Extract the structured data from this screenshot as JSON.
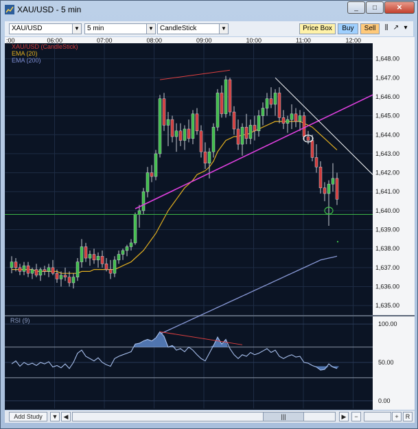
{
  "window": {
    "title": "XAU/USD - 5 min",
    "controls": [
      "_",
      "□",
      "✕"
    ]
  },
  "toolbar": {
    "symbol": "XAU/USD",
    "interval": "5 min",
    "chart_style": "CandleStick",
    "price_box_label": "Price Box",
    "buy_label": "Buy",
    "sell_label": "Sell",
    "colors": {
      "price_box": "#fff2a8",
      "buy": "#9fd0ff",
      "sell": "#ffc97a"
    }
  },
  "legend": [
    {
      "label": "XAU/USD (CandleStick)",
      "color": "#d33b3b"
    },
    {
      "label": "EMA (20)",
      "color": "#e3b020"
    },
    {
      "label": "EMA (200)",
      "color": "#7f8fd6"
    }
  ],
  "rsi_label": "RSI (9)",
  "bottom": {
    "add_study": "Add Study",
    "r_label": "R",
    "plus": "+",
    "minus": "−"
  },
  "chart_data": [
    {
      "type": "candlestick",
      "title": "XAU/USD - 5 min",
      "time_labels": [
        ":00",
        "06:00",
        "07:00",
        "08:00",
        "09:00",
        "10:00",
        "11:00",
        "12:00"
      ],
      "ylim": [
        1634.5,
        1649.0
      ],
      "y_tick_labels": [
        "1,648.00",
        "1,647.00",
        "1,646.00",
        "1,645.00",
        "1,644.00",
        "1,643.00",
        "1,642.00",
        "1,641.00",
        "1,640.00",
        "1,639.00",
        "1,638.00",
        "1,637.00",
        "1,636.00",
        "1,635.00"
      ],
      "y_ticks": [
        1648,
        1647,
        1646,
        1645,
        1644,
        1643,
        1642,
        1641,
        1640,
        1639,
        1638,
        1637,
        1636,
        1635
      ],
      "candles": [
        [
          1637.0,
          1637.6,
          1636.7,
          1637.3
        ],
        [
          1637.3,
          1637.5,
          1636.8,
          1637.0
        ],
        [
          1637.0,
          1637.2,
          1636.6,
          1636.8
        ],
        [
          1636.8,
          1637.3,
          1636.6,
          1637.1
        ],
        [
          1637.1,
          1637.3,
          1636.5,
          1636.7
        ],
        [
          1636.7,
          1637.0,
          1636.4,
          1636.9
        ],
        [
          1636.9,
          1637.2,
          1636.5,
          1636.6
        ],
        [
          1636.6,
          1637.0,
          1636.3,
          1636.9
        ],
        [
          1636.9,
          1637.1,
          1636.6,
          1636.8
        ],
        [
          1636.8,
          1637.2,
          1636.5,
          1637.0
        ],
        [
          1637.0,
          1637.4,
          1636.6,
          1636.7
        ],
        [
          1636.7,
          1636.9,
          1636.2,
          1636.4
        ],
        [
          1636.4,
          1636.8,
          1636.0,
          1636.6
        ],
        [
          1636.6,
          1637.0,
          1636.3,
          1636.5
        ],
        [
          1636.5,
          1636.8,
          1636.0,
          1636.2
        ],
        [
          1636.2,
          1636.7,
          1635.9,
          1636.5
        ],
        [
          1636.5,
          1637.5,
          1636.3,
          1637.3
        ],
        [
          1637.3,
          1638.5,
          1637.0,
          1638.1
        ],
        [
          1638.1,
          1638.3,
          1637.3,
          1637.5
        ],
        [
          1637.5,
          1637.9,
          1637.1,
          1637.7
        ],
        [
          1637.7,
          1638.0,
          1637.2,
          1637.4
        ],
        [
          1637.4,
          1637.8,
          1637.0,
          1637.6
        ],
        [
          1637.6,
          1637.9,
          1637.0,
          1637.2
        ],
        [
          1637.2,
          1637.5,
          1636.8,
          1636.9
        ],
        [
          1636.9,
          1637.4,
          1636.4,
          1636.7
        ],
        [
          1636.7,
          1637.6,
          1636.5,
          1637.4
        ],
        [
          1637.4,
          1637.9,
          1637.2,
          1637.7
        ],
        [
          1637.7,
          1638.0,
          1637.4,
          1637.9
        ],
        [
          1637.9,
          1638.2,
          1637.6,
          1638.1
        ],
        [
          1638.1,
          1638.5,
          1637.9,
          1638.3
        ],
        [
          1638.3,
          1639.9,
          1638.2,
          1639.8
        ],
        [
          1639.8,
          1640.3,
          1639.1,
          1640.0
        ],
        [
          1640.0,
          1641.2,
          1639.8,
          1641.0
        ],
        [
          1641.0,
          1642.3,
          1640.7,
          1642.0
        ],
        [
          1642.0,
          1642.4,
          1641.5,
          1641.8
        ],
        [
          1641.8,
          1643.2,
          1641.6,
          1643.0
        ],
        [
          1643.0,
          1646.1,
          1642.8,
          1645.9
        ],
        [
          1645.9,
          1646.2,
          1644.2,
          1644.5
        ],
        [
          1644.5,
          1645.2,
          1643.4,
          1644.8
        ],
        [
          1644.8,
          1645.0,
          1643.6,
          1643.9
        ],
        [
          1643.9,
          1644.6,
          1643.1,
          1644.2
        ],
        [
          1644.2,
          1644.6,
          1643.4,
          1643.7
        ],
        [
          1643.7,
          1644.5,
          1643.2,
          1644.3
        ],
        [
          1644.3,
          1644.8,
          1643.6,
          1643.8
        ],
        [
          1643.8,
          1645.3,
          1643.5,
          1645.1
        ],
        [
          1645.1,
          1645.4,
          1644.0,
          1644.2
        ],
        [
          1644.2,
          1644.5,
          1642.8,
          1643.1
        ],
        [
          1643.1,
          1643.6,
          1642.2,
          1642.5
        ],
        [
          1642.5,
          1643.3,
          1641.7,
          1643.1
        ],
        [
          1643.1,
          1644.6,
          1642.8,
          1644.4
        ],
        [
          1644.4,
          1646.4,
          1644.2,
          1646.2
        ],
        [
          1646.2,
          1646.6,
          1644.9,
          1645.1
        ],
        [
          1645.1,
          1647.1,
          1644.9,
          1646.9
        ],
        [
          1646.9,
          1647.0,
          1645.0,
          1645.2
        ],
        [
          1645.2,
          1645.5,
          1644.0,
          1644.3
        ],
        [
          1644.3,
          1644.8,
          1643.2,
          1643.5
        ],
        [
          1643.5,
          1644.6,
          1642.9,
          1644.4
        ],
        [
          1644.4,
          1645.1,
          1643.5,
          1643.8
        ],
        [
          1643.8,
          1644.8,
          1643.5,
          1644.5
        ],
        [
          1644.5,
          1645.0,
          1643.7,
          1644.2
        ],
        [
          1644.2,
          1645.3,
          1643.9,
          1645.0
        ],
        [
          1645.0,
          1645.7,
          1644.5,
          1645.4
        ],
        [
          1645.4,
          1646.2,
          1645.0,
          1645.9
        ],
        [
          1645.9,
          1646.5,
          1645.4,
          1645.6
        ],
        [
          1645.6,
          1646.4,
          1645.0,
          1646.2
        ],
        [
          1646.2,
          1646.5,
          1644.6,
          1644.9
        ],
        [
          1644.9,
          1645.3,
          1644.3,
          1644.6
        ],
        [
          1644.6,
          1645.0,
          1644.1,
          1644.8
        ],
        [
          1644.8,
          1645.6,
          1644.3,
          1645.1
        ],
        [
          1645.1,
          1645.4,
          1644.4,
          1644.7
        ],
        [
          1644.7,
          1645.3,
          1644.2,
          1645.0
        ],
        [
          1645.0,
          1645.2,
          1643.7,
          1643.9
        ],
        [
          1643.9,
          1644.2,
          1643.5,
          1643.7
        ],
        [
          1643.7,
          1644.0,
          1642.6,
          1642.8
        ],
        [
          1642.8,
          1643.5,
          1642.0,
          1642.3
        ],
        [
          1642.3,
          1642.6,
          1640.9,
          1641.2
        ],
        [
          1641.2,
          1641.5,
          1640.5,
          1640.9
        ],
        [
          1640.9,
          1641.6,
          1639.2,
          1641.4
        ],
        [
          1641.4,
          1642.5,
          1641.0,
          1641.7
        ],
        [
          1641.7,
          1642.0,
          1640.3,
          1640.6
        ]
      ],
      "series": [
        {
          "name": "EMA (20)",
          "values": [
            1636.9,
            1636.9,
            1636.9,
            1636.9,
            1636.9,
            1636.9,
            1636.8,
            1636.8,
            1636.8,
            1636.8,
            1636.8,
            1636.8,
            1636.7,
            1636.7,
            1636.7,
            1636.7,
            1636.7,
            1636.8,
            1636.8,
            1636.8,
            1636.9,
            1636.9,
            1636.9,
            1636.9,
            1636.9,
            1636.9,
            1637.0,
            1637.1,
            1637.2,
            1637.3,
            1637.5,
            1637.7,
            1637.9,
            1638.2,
            1638.5,
            1638.8,
            1639.2,
            1639.6,
            1640.0,
            1640.3,
            1640.6,
            1640.9,
            1641.2,
            1641.4,
            1641.6,
            1641.9,
            1642.0,
            1642.1,
            1642.3,
            1642.6,
            1643.1,
            1643.4,
            1643.7,
            1643.8,
            1643.9,
            1643.9,
            1644.0,
            1644.0,
            1644.1,
            1644.2,
            1644.3,
            1644.4,
            1644.5,
            1644.6,
            1644.7,
            1644.7,
            1644.7,
            1644.7,
            1644.7,
            1644.7,
            1644.7,
            1644.6,
            1644.5,
            1644.4,
            1644.2,
            1644.0,
            1643.8,
            1643.6,
            1643.4,
            1643.2
          ]
        },
        {
          "name": "EMA (200)",
          "values": [
            1633.5,
            1633.6,
            1633.7,
            1633.8,
            1633.9,
            1634.0,
            1634.1,
            1634.2,
            1634.3,
            1634.4,
            1634.5,
            1634.6,
            1634.7,
            1634.8,
            1634.9,
            1635.0,
            1635.1,
            1635.2,
            1635.3,
            1635.4,
            1635.5,
            1635.6,
            1635.7,
            1635.8,
            1635.9,
            1636.0,
            1636.1,
            1636.2,
            1636.3,
            1636.4,
            1636.5,
            1636.6,
            1636.7,
            1636.8,
            1636.9,
            1637.0,
            1637.1,
            1637.2,
            1637.3,
            1637.4,
            1637.45,
            1637.5,
            1637.55,
            1637.6
          ]
        }
      ],
      "annotations": {
        "horizontal_level": 1639.8
      }
    },
    {
      "type": "line",
      "title": "RSI (9)",
      "ylim": [
        -10,
        110
      ],
      "y_tick_labels": [
        "100.00",
        "50.00",
        "0.00"
      ],
      "y_ticks": [
        100,
        50,
        0
      ],
      "series": [
        {
          "name": "RSI (9)",
          "values": [
            48,
            52,
            45,
            50,
            47,
            49,
            46,
            50,
            48,
            51,
            44,
            46,
            43,
            48,
            42,
            50,
            62,
            66,
            58,
            55,
            52,
            56,
            50,
            47,
            45,
            55,
            58,
            60,
            62,
            64,
            74,
            75,
            78,
            80,
            78,
            82,
            90,
            84,
            70,
            72,
            66,
            68,
            64,
            70,
            66,
            60,
            55,
            52,
            62,
            72,
            83,
            74,
            80,
            68,
            60,
            55,
            60,
            58,
            63,
            60,
            62,
            65,
            68,
            63,
            66,
            58,
            55,
            58,
            60,
            57,
            58,
            50,
            49,
            46,
            44,
            40,
            41,
            48,
            44,
            42
          ]
        }
      ]
    }
  ]
}
